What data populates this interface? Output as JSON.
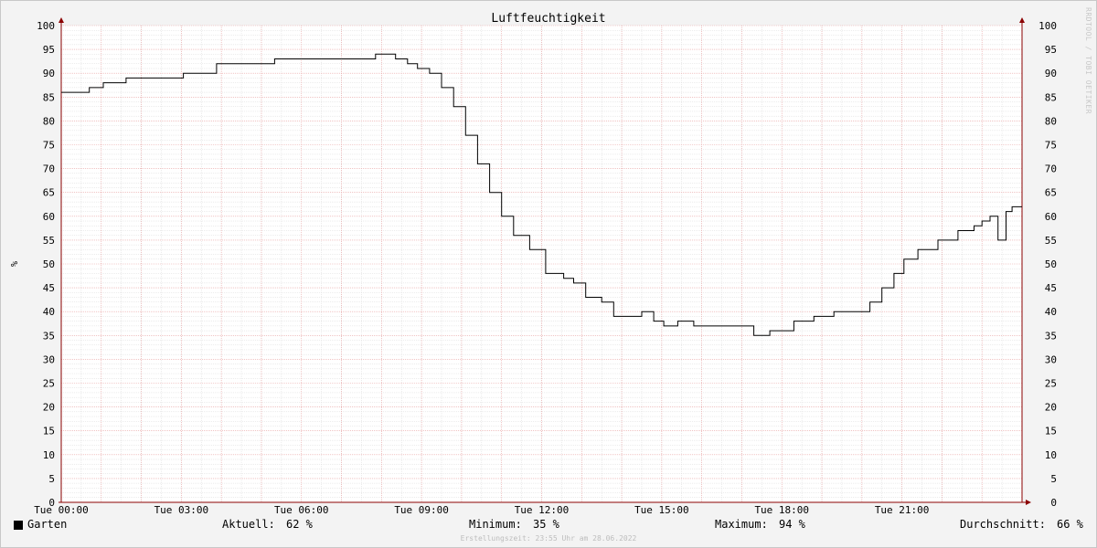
{
  "chart_data": {
    "type": "line",
    "title": "Luftfeuchtigkeit",
    "ylabel": "%",
    "xlabel": "",
    "ylim": [
      0,
      100
    ],
    "xlim": [
      0,
      24
    ],
    "y_ticks": [
      0,
      5,
      10,
      15,
      20,
      25,
      30,
      35,
      40,
      45,
      50,
      55,
      60,
      65,
      70,
      75,
      80,
      85,
      90,
      95,
      100
    ],
    "x_ticks": [
      {
        "x": 0,
        "label": "Tue 00:00"
      },
      {
        "x": 3,
        "label": "Tue 03:00"
      },
      {
        "x": 6,
        "label": "Tue 06:00"
      },
      {
        "x": 9,
        "label": "Tue 09:00"
      },
      {
        "x": 12,
        "label": "Tue 12:00"
      },
      {
        "x": 15,
        "label": "Tue 15:00"
      },
      {
        "x": 18,
        "label": "Tue 18:00"
      },
      {
        "x": 21,
        "label": "Tue 21:00"
      }
    ],
    "grid": true,
    "series": [
      {
        "name": "Garten",
        "color": "#000000",
        "x": [
          0,
          0.33,
          0.7,
          1.05,
          1.62,
          3.05,
          3.88,
          5.33,
          7.85,
          8.35,
          8.65,
          8.9,
          9.2,
          9.5,
          9.8,
          10.1,
          10.4,
          10.7,
          11.0,
          11.3,
          11.7,
          12.1,
          12.55,
          12.8,
          13.1,
          13.5,
          13.8,
          14.15,
          14.5,
          14.8,
          15.05,
          15.4,
          15.8,
          16.3,
          16.8,
          17.3,
          17.7,
          18.0,
          18.3,
          18.8,
          19.3,
          19.8,
          20.2,
          20.5,
          20.8,
          21.05,
          21.4,
          21.9,
          22.4,
          22.8,
          23.0,
          23.2,
          23.38,
          23.4,
          23.6,
          23.75,
          24.0
        ],
        "y": [
          86,
          86,
          87,
          88,
          89,
          90,
          92,
          93,
          94,
          93,
          92,
          91,
          90,
          87,
          83,
          77,
          71,
          65,
          60,
          56,
          53,
          48,
          47,
          46,
          43,
          42,
          39,
          39,
          40,
          38,
          37,
          38,
          37,
          37,
          37,
          35,
          36,
          36,
          38,
          39,
          40,
          40,
          42,
          45,
          48,
          51,
          53,
          55,
          57,
          58,
          59,
          60,
          60,
          55,
          61,
          62,
          62
        ]
      }
    ]
  },
  "legend": {
    "series_name": "Garten",
    "current_label": "Aktuell:",
    "current_value": "62 %",
    "min_label": "Minimum:",
    "min_value": "35 %",
    "max_label": "Maximum:",
    "max_value": "94 %",
    "avg_label": "Durchschnitt:",
    "avg_value": "66 %"
  },
  "footer": "Erstellungszeit: 23:55 Uhr am 28.06.2022",
  "watermark": "RRDTOOL / TOBI OETIKER",
  "colors": {
    "plot_background": "#ffffff",
    "minor_grid": "#d9d9d9",
    "major_grid": "#e8a0a0",
    "axis": "#8b0000",
    "line": "#000000"
  }
}
